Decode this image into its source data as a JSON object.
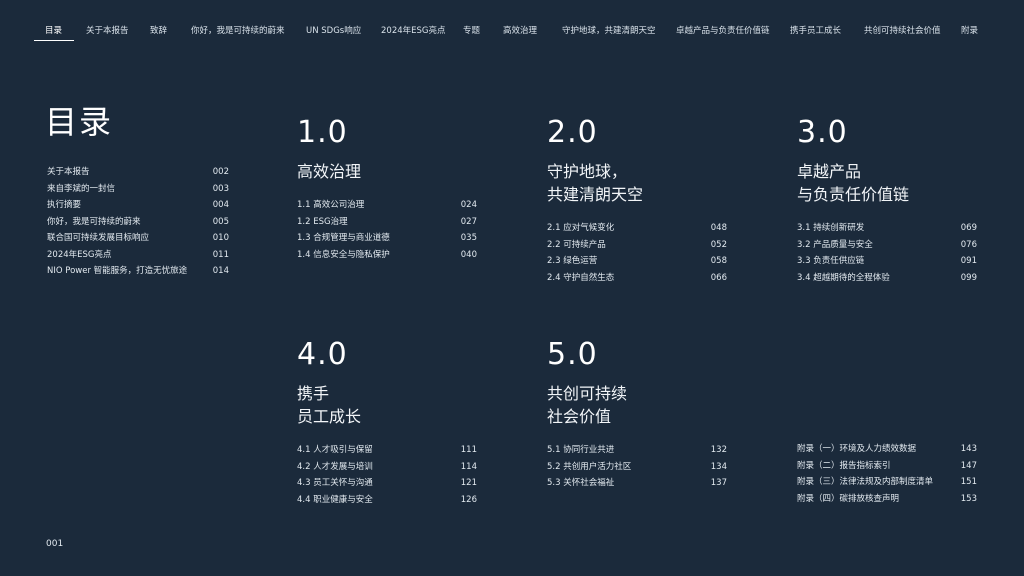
{
  "nav": [
    {
      "label": "目录",
      "active": true
    },
    {
      "label": "关于本报告"
    },
    {
      "label": "致辞"
    },
    {
      "label": "你好，我是可持续的蔚来"
    },
    {
      "label": "UN SDGs响应"
    },
    {
      "label": "2024年ESG亮点"
    },
    {
      "label": "专题"
    },
    {
      "label": "高效治理"
    },
    {
      "label": "守护地球，共建清朗天空"
    },
    {
      "label": "卓越产品与负责任价值链"
    },
    {
      "label": "携手员工成长"
    },
    {
      "label": "共创可持续社会价值"
    },
    {
      "label": "附录"
    }
  ],
  "page_title": "目录",
  "left_toc": [
    {
      "label": "关于本报告",
      "page": "002"
    },
    {
      "label": "来自李斌的一封信",
      "page": "003"
    },
    {
      "label": "执行摘要",
      "page": "004"
    },
    {
      "label": "你好，我是可持续的蔚来",
      "page": "005"
    },
    {
      "label": "联合国可持续发展目标响应",
      "page": "010"
    },
    {
      "label": "2024年ESG亮点",
      "page": "011"
    },
    {
      "label": "NIO Power 智能服务，打造无忧旅途",
      "page": "014"
    }
  ],
  "sections": [
    {
      "num": "1.0",
      "title1": "高效治理",
      "title2": "",
      "items": [
        {
          "label": "1.1  高效公司治理",
          "page": "024"
        },
        {
          "label": "1.2  ESG治理",
          "page": "027"
        },
        {
          "label": "1.3  合规管理与商业道德",
          "page": "035"
        },
        {
          "label": "1.4  信息安全与隐私保护",
          "page": "040"
        }
      ]
    },
    {
      "num": "2.0",
      "title1": "守护地球，",
      "title2": "共建清朗天空",
      "items": [
        {
          "label": "2.1  应对气候变化",
          "page": "048"
        },
        {
          "label": "2.2  可持续产品",
          "page": "052"
        },
        {
          "label": "2.3  绿色运营",
          "page": "058"
        },
        {
          "label": "2.4  守护自然生态",
          "page": "066"
        }
      ]
    },
    {
      "num": "3.0",
      "title1": "卓越产品",
      "title2": "与负责任价值链",
      "items": [
        {
          "label": "3.1  持续创新研发",
          "page": "069"
        },
        {
          "label": "3.2  产品质量与安全",
          "page": "076"
        },
        {
          "label": "3.3  负责任供应链",
          "page": "091"
        },
        {
          "label": "3.4  超越期待的全程体验",
          "page": "099"
        }
      ]
    },
    {
      "num": "4.0",
      "title1": "携手",
      "title2": "员工成长",
      "items": [
        {
          "label": "4.1  人才吸引与保留",
          "page": "111"
        },
        {
          "label": "4.2  人才发展与培训",
          "page": "114"
        },
        {
          "label": "4.3  员工关怀与沟通",
          "page": "121"
        },
        {
          "label": "4.4  职业健康与安全",
          "page": "126"
        }
      ]
    },
    {
      "num": "5.0",
      "title1": "共创可持续",
      "title2": "社会价值",
      "items": [
        {
          "label": "5.1  协同行业共进",
          "page": "132"
        },
        {
          "label": "5.2  共创用户活力社区",
          "page": "134"
        },
        {
          "label": "5.3  关怀社会福祉",
          "page": "137"
        }
      ]
    }
  ],
  "appendix": [
    {
      "label": "附录（一）环境及人力绩效数据",
      "page": "143"
    },
    {
      "label": "附录（二）报告指标索引",
      "page": "147"
    },
    {
      "label": "附录（三）法律法规及内部制度清单",
      "page": "151"
    },
    {
      "label": "附录（四）碳排放核查声明",
      "page": "153"
    }
  ],
  "page_number": "001"
}
